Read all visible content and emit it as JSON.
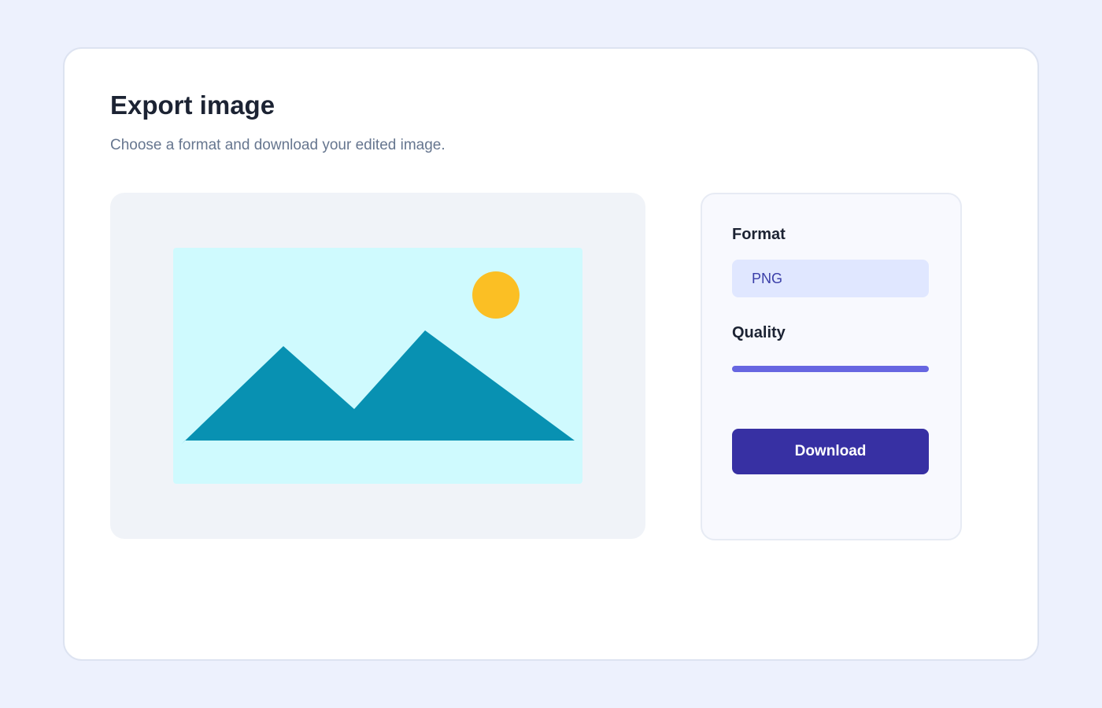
{
  "header": {
    "title": "Export image",
    "subtitle": "Choose a format and download your edited image."
  },
  "preview": {
    "icon": "landscape-image-icon",
    "colors": {
      "panel": "#f0f3f8",
      "sky": "#cffafe",
      "mountains": "#0891b2",
      "sun": "#fbbf24"
    }
  },
  "settings": {
    "format_label": "Format",
    "format_value": "PNG",
    "quality_label": "Quality",
    "quality_value": 1.0,
    "download_label": "Download"
  },
  "colors": {
    "page_background": "#edf1fd",
    "accent": "#3730a3",
    "slider": "#6766e1",
    "select_background": "#e0e7ff"
  }
}
